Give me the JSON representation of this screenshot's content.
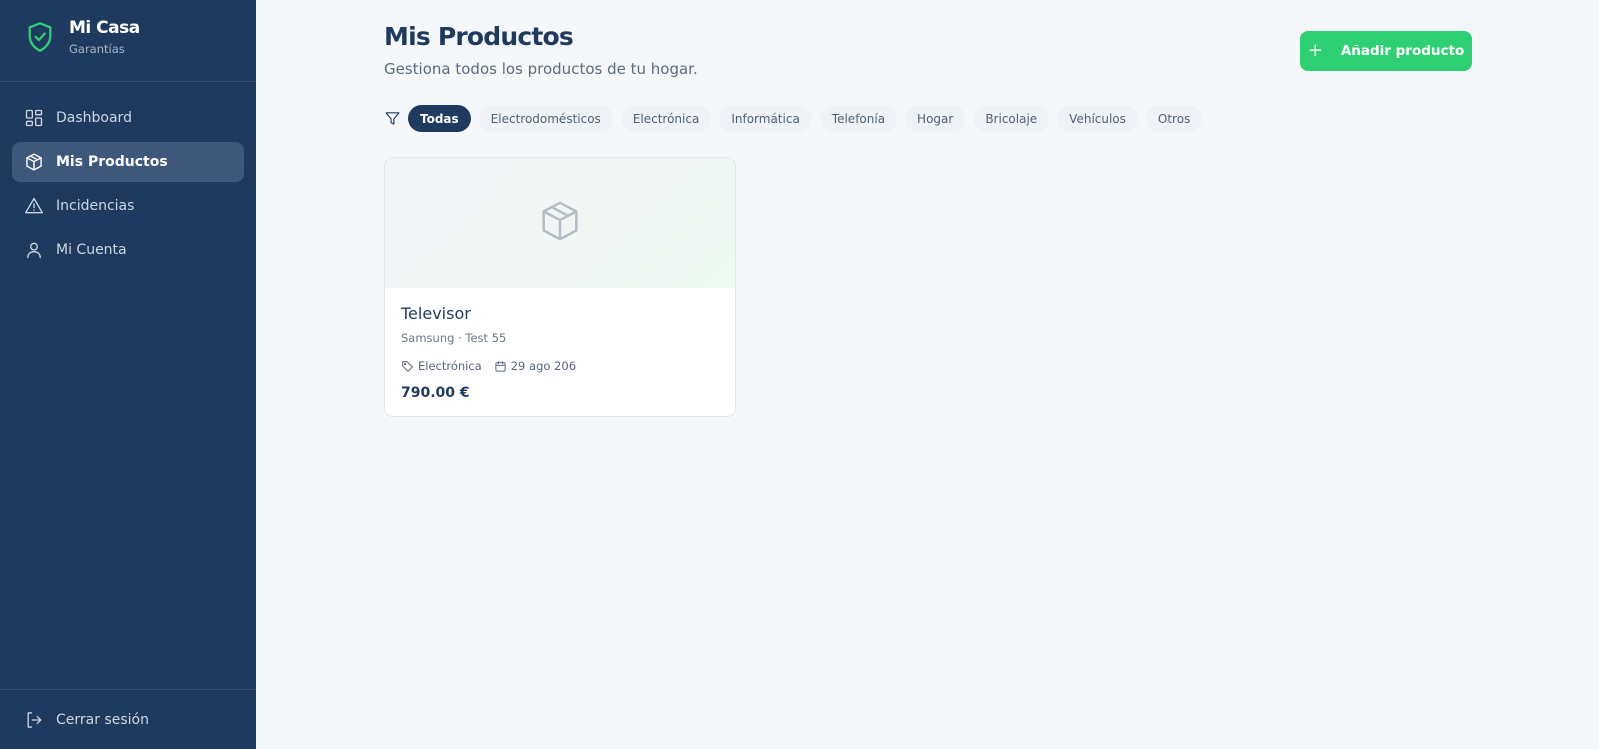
{
  "brand": {
    "title": "Mi Casa",
    "subtitle": "Garantías",
    "accent_color": "#2fd073",
    "icon": "shield-check-icon"
  },
  "sidebar": {
    "background": "#1f3a5f",
    "items": [
      {
        "label": "Dashboard",
        "icon": "dashboard-grid-icon",
        "active": false
      },
      {
        "label": "Mis Productos",
        "icon": "package-icon",
        "active": true
      },
      {
        "label": "Incidencias",
        "icon": "warning-triangle-icon",
        "active": false
      },
      {
        "label": "Mi Cuenta",
        "icon": "user-icon",
        "active": false
      }
    ],
    "logout": {
      "label": "Cerrar sesión",
      "icon": "logout-icon"
    }
  },
  "main": {
    "title": "Mis Productos",
    "subtitle": "Gestiona todos los productos de tu hogar.",
    "add_button": {
      "label": "Añadir producto",
      "icon": "plus-icon",
      "color": "#2fd073"
    },
    "filters": {
      "icon": "filter-icon",
      "selected": "Todas",
      "chips": [
        "Todas",
        "Electrodomésticos",
        "Electrónica",
        "Informática",
        "Telefonía",
        "Hogar",
        "Bricolaje",
        "Vehículos",
        "Otros"
      ]
    },
    "products": [
      {
        "name": "Televisor",
        "brand_model": "Samsung · Test 55",
        "category": "Electrónica",
        "date": "29 ago 206",
        "price": "790.00 €",
        "image_icon": "package-icon"
      }
    ]
  }
}
